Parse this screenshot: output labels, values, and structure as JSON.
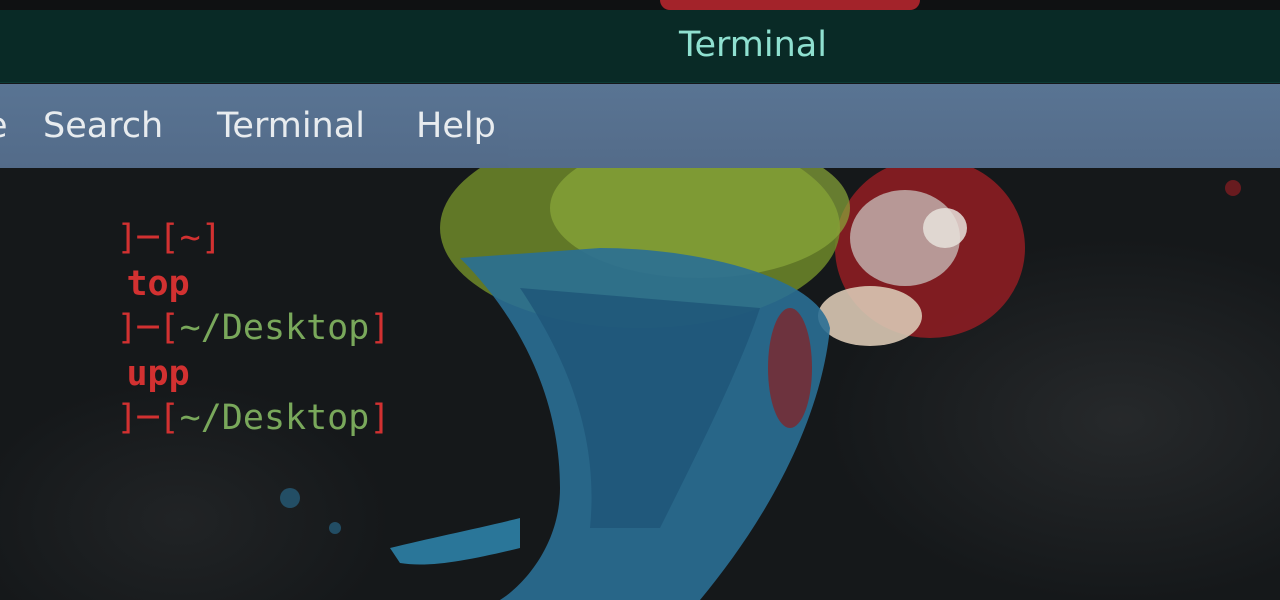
{
  "window": {
    "title": "Terminal"
  },
  "menubar": {
    "items": [
      {
        "label": "e"
      },
      {
        "label": "Search"
      },
      {
        "label": "Terminal"
      },
      {
        "label": "Help"
      }
    ]
  },
  "terminal": {
    "lines": [
      {
        "segments": [
          {
            "text": "]─[",
            "color": "red"
          },
          {
            "text": "~",
            "color": "red"
          },
          {
            "text": "]",
            "color": "red"
          }
        ]
      },
      {
        "segments": [
          {
            "text": "top",
            "color": "cmd"
          }
        ]
      },
      {
        "segments": [
          {
            "text": "]─[",
            "color": "red"
          },
          {
            "text": "~/Desktop",
            "color": "green"
          },
          {
            "text": "]",
            "color": "red"
          }
        ]
      },
      {
        "segments": [
          {
            "text": "upp",
            "color": "cmd"
          }
        ]
      },
      {
        "segments": [
          {
            "text": "]─[",
            "color": "red"
          },
          {
            "text": "~/Desktop",
            "color": "green"
          },
          {
            "text": "]",
            "color": "red"
          }
        ]
      }
    ]
  },
  "colors": {
    "titlebar": "#092a26",
    "title_text": "#8fe0d0",
    "menubar": "#5a7594",
    "prompt_red": "#d23131",
    "path_green": "#79a85b"
  }
}
